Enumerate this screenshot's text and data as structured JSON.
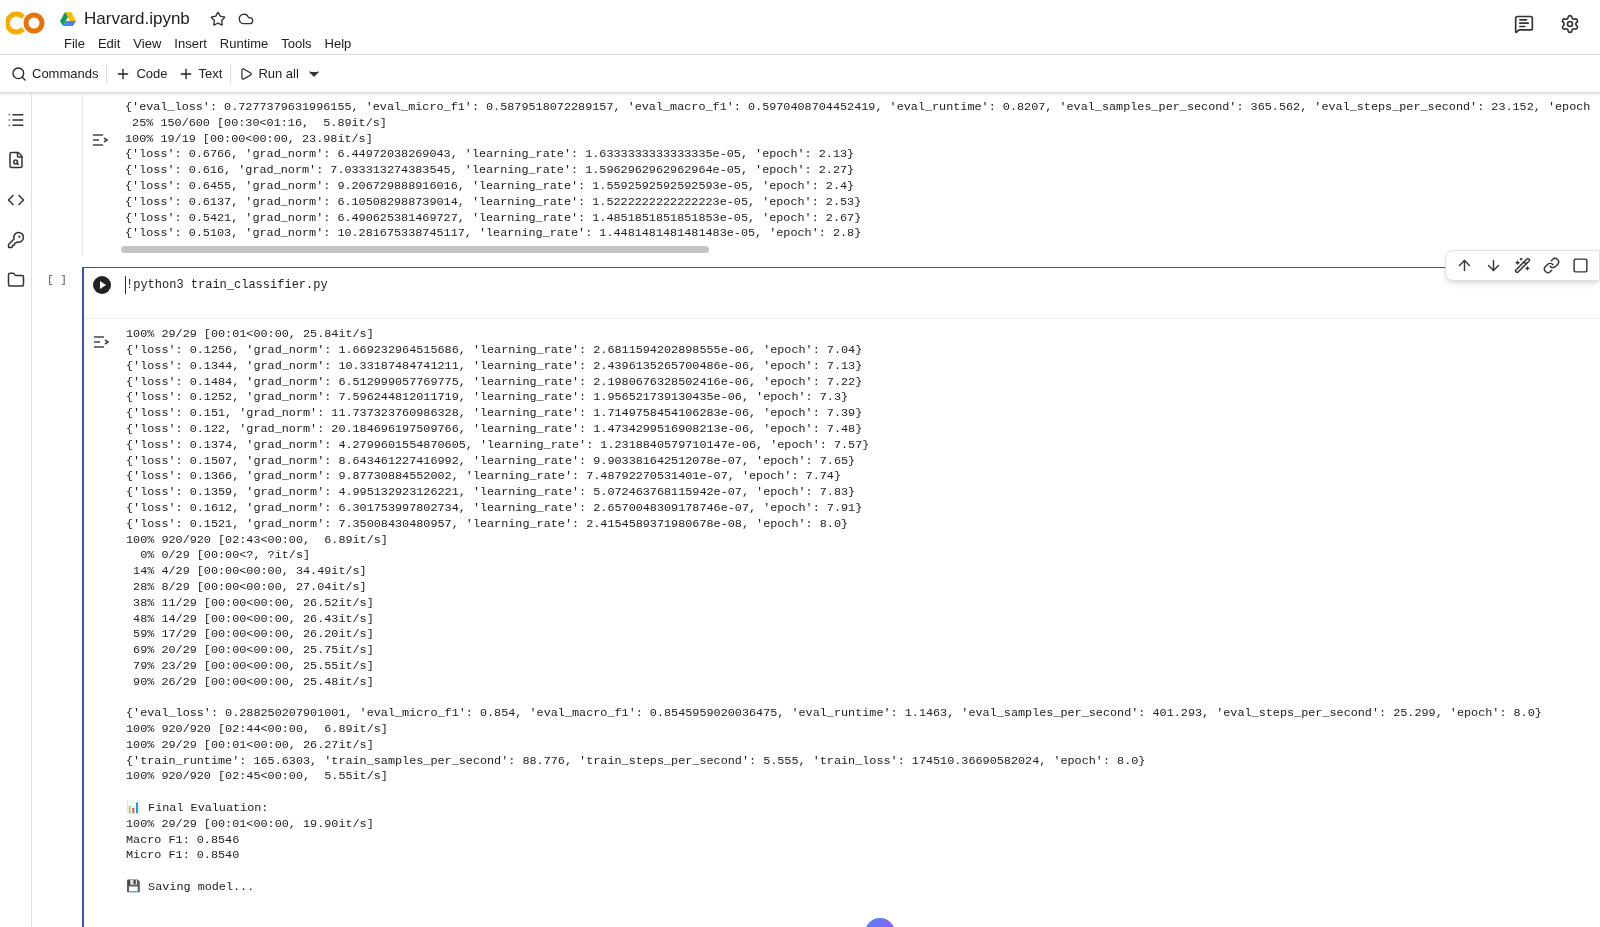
{
  "notebook": {
    "title": "Harvard.ipynb",
    "starred": false
  },
  "menu": [
    "File",
    "Edit",
    "View",
    "Insert",
    "Runtime",
    "Tools",
    "Help"
  ],
  "toolbar": [
    {
      "label": "Commands",
      "kind": "search"
    },
    {
      "label": "Code",
      "kind": "add"
    },
    {
      "label": "Text",
      "kind": "add"
    },
    {
      "label": "Run all",
      "kind": "run",
      "dropdown": true
    }
  ],
  "cells": [
    {
      "focused": false,
      "output_blocks": [
        [
          "{'eval_loss': 0.7277379631996155, 'eval_micro_f1': 0.5879518072289157, 'eval_macro_f1': 0.5970408704452419, 'eval_runtime': 0.8207, 'eval_samples_per_second': 365.562, 'eval_steps_per_second': 23.152, 'epoch",
          " 25% 150/600 [00:30<01:16,  5.89it/s]",
          "100% 19/19 [00:00<00:00, 23.98it/s]",
          "{'loss': 0.6766, 'grad_norm': 6.44972038269043, 'learning_rate': 1.6333333333333335e-05, 'epoch': 2.13}",
          "{'loss': 0.616, 'grad_norm': 7.033313274383545, 'learning_rate': 1.5962962962962964e-05, 'epoch': 2.27}",
          "{'loss': 0.6455, 'grad_norm': 9.206729888916016, 'learning_rate': 1.5592592592592593e-05, 'epoch': 2.4}",
          "{'loss': 0.6137, 'grad_norm': 6.105082988739014, 'learning_rate': 1.5222222222222223e-05, 'epoch': 2.53}",
          "{'loss': 0.5421, 'grad_norm': 6.490625381469727, 'learning_rate': 1.4851851851851853e-05, 'epoch': 2.67}",
          "{'loss': 0.5103, 'grad_norm': 10.281675338745117, 'learning_rate': 1.4481481481481483e-05, 'epoch': 2.8}"
        ]
      ]
    },
    {
      "focused": true,
      "exec_count": "[ ]",
      "code": "!python3 train_classifier.py",
      "output_blocks": [
        [
          "100% 29/29 [00:01<00:00, 25.84it/s]",
          "{'loss': 0.1256, 'grad_norm': 1.669232964515686, 'learning_rate': 2.6811594202898555e-06, 'epoch': 7.04}",
          "{'loss': 0.1344, 'grad_norm': 10.33187484741211, 'learning_rate': 2.4396135265700486e-06, 'epoch': 7.13}",
          "{'loss': 0.1484, 'grad_norm': 6.512999057769775, 'learning_rate': 2.1980676328502416e-06, 'epoch': 7.22}",
          "{'loss': 0.1252, 'grad_norm': 7.596244812011719, 'learning_rate': 1.956521739130435e-06, 'epoch': 7.3}",
          "{'loss': 0.151, 'grad_norm': 11.737323760986328, 'learning_rate': 1.7149758454106283e-06, 'epoch': 7.39}",
          "{'loss': 0.122, 'grad_norm': 20.184696197509766, 'learning_rate': 1.4734299516908213e-06, 'epoch': 7.48}",
          "{'loss': 0.1374, 'grad_norm': 4.2799601554870605, 'learning_rate': 1.2318840579710147e-06, 'epoch': 7.57}",
          "{'loss': 0.1507, 'grad_norm': 8.643461227416992, 'learning_rate': 9.903381642512078e-07, 'epoch': 7.65}",
          "{'loss': 0.1366, 'grad_norm': 9.87730884552002, 'learning_rate': 7.48792270531401e-07, 'epoch': 7.74}",
          "{'loss': 0.1359, 'grad_norm': 4.995132923126221, 'learning_rate': 5.072463768115942e-07, 'epoch': 7.83}",
          "{'loss': 0.1612, 'grad_norm': 6.301753997802734, 'learning_rate': 2.6570048309178746e-07, 'epoch': 7.91}",
          "{'loss': 0.1521, 'grad_norm': 7.35008430480957, 'learning_rate': 2.4154589371980678e-08, 'epoch': 8.0}",
          "100% 920/920 [02:43<00:00,  6.89it/s]",
          "  0% 0/29 [00:00<?, ?it/s]",
          " 14% 4/29 [00:00<00:00, 34.49it/s]",
          " 28% 8/29 [00:00<00:00, 27.04it/s]",
          " 38% 11/29 [00:00<00:00, 26.52it/s]",
          " 48% 14/29 [00:00<00:00, 26.43it/s]",
          " 59% 17/29 [00:00<00:00, 26.20it/s]",
          " 69% 20/29 [00:00<00:00, 25.75it/s]",
          " 79% 23/29 [00:00<00:00, 25.55it/s]",
          " 90% 26/29 [00:00<00:00, 25.48it/s]"
        ],
        [
          "{'eval_loss': 0.288250207901001, 'eval_micro_f1': 0.854, 'eval_macro_f1': 0.8545959020036475, 'eval_runtime': 1.1463, 'eval_samples_per_second': 401.293, 'eval_steps_per_second': 25.299, 'epoch': 8.0}",
          "100% 920/920 [02:44<00:00,  6.89it/s]",
          "100% 29/29 [00:01<00:00, 26.27it/s]",
          "{'train_runtime': 165.6303, 'train_samples_per_second': 88.776, 'train_steps_per_second': 5.555, 'train_loss': 174510.36690582024, 'epoch': 8.0}",
          "100% 920/920 [02:45<00:00,  5.55it/s]"
        ],
        [
          "📊 Final Evaluation:",
          "100% 29/29 [00:01<00:00, 19.90it/s]",
          "Macro F1: 0.8546",
          "Micro F1: 0.8540"
        ],
        [
          "💾 Saving model..."
        ]
      ]
    }
  ]
}
